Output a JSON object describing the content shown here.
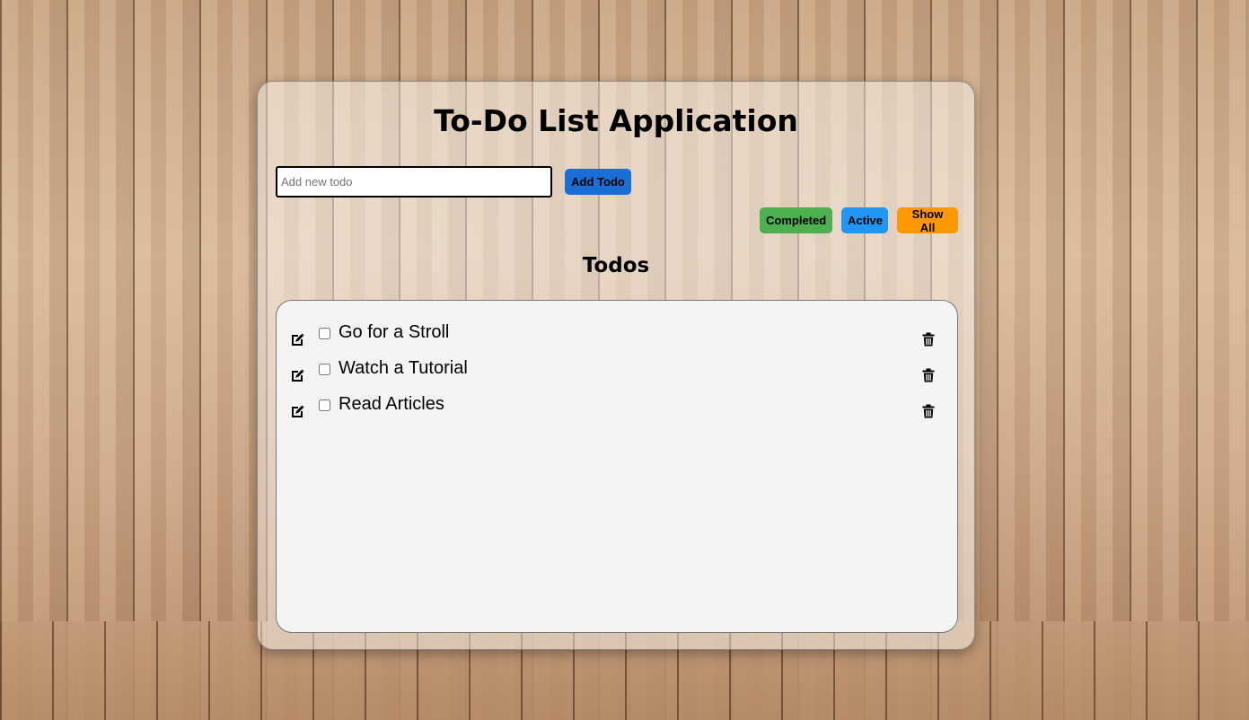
{
  "app": {
    "title": "To-Do List Application"
  },
  "input": {
    "placeholder": "Add new todo",
    "value": ""
  },
  "buttons": {
    "add_label": "Add Todo",
    "completed_label": "Completed",
    "active_label": "Active",
    "show_all_label": "Show All"
  },
  "colors": {
    "add": "#1a6ed4",
    "completed": "#4caf50",
    "active": "#2196f3",
    "show_all": "#ff9800"
  },
  "list": {
    "heading": "Todos",
    "items": [
      {
        "text": "Go for a Stroll",
        "done": false,
        "edit_icon": "edit-icon",
        "delete_icon": "trash-icon"
      },
      {
        "text": "Watch a Tutorial",
        "done": false,
        "edit_icon": "edit-icon",
        "delete_icon": "trash-icon"
      },
      {
        "text": "Read Articles",
        "done": false,
        "edit_icon": "edit-icon",
        "delete_icon": "trash-icon"
      }
    ]
  }
}
